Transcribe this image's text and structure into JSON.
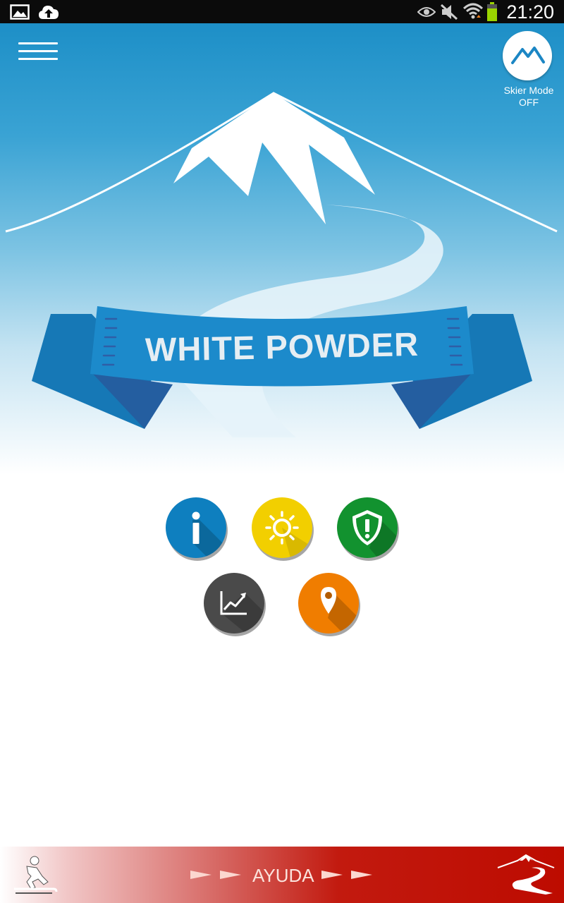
{
  "status_bar": {
    "time": "21:20",
    "left_icons": [
      "image-icon",
      "cloud-upload-icon"
    ],
    "right_icons": [
      "eye-icon",
      "mute-icon",
      "wifi-icon",
      "battery-icon"
    ]
  },
  "header": {
    "menu_icon": "hamburger-menu-icon",
    "skier_mode": {
      "line1": "Skier Mode",
      "line2": "OFF",
      "icon": "mountain-icon"
    }
  },
  "banner": {
    "title": "WHITE POWDER"
  },
  "actions": [
    {
      "icon": "info-icon",
      "color": "#0e7fbf"
    },
    {
      "icon": "sun-icon",
      "color": "#f2cf00"
    },
    {
      "icon": "shield-alert-icon",
      "color": "#12922f"
    },
    {
      "icon": "chart-icon",
      "color": "#4a4a4a"
    },
    {
      "icon": "location-pin-icon",
      "color": "#f07d00"
    }
  ],
  "footer": {
    "help_label": "AYUDA",
    "left_icon": "skier-icon",
    "right_icon": "mountain-logo-icon",
    "accent": "#bd0b00"
  }
}
